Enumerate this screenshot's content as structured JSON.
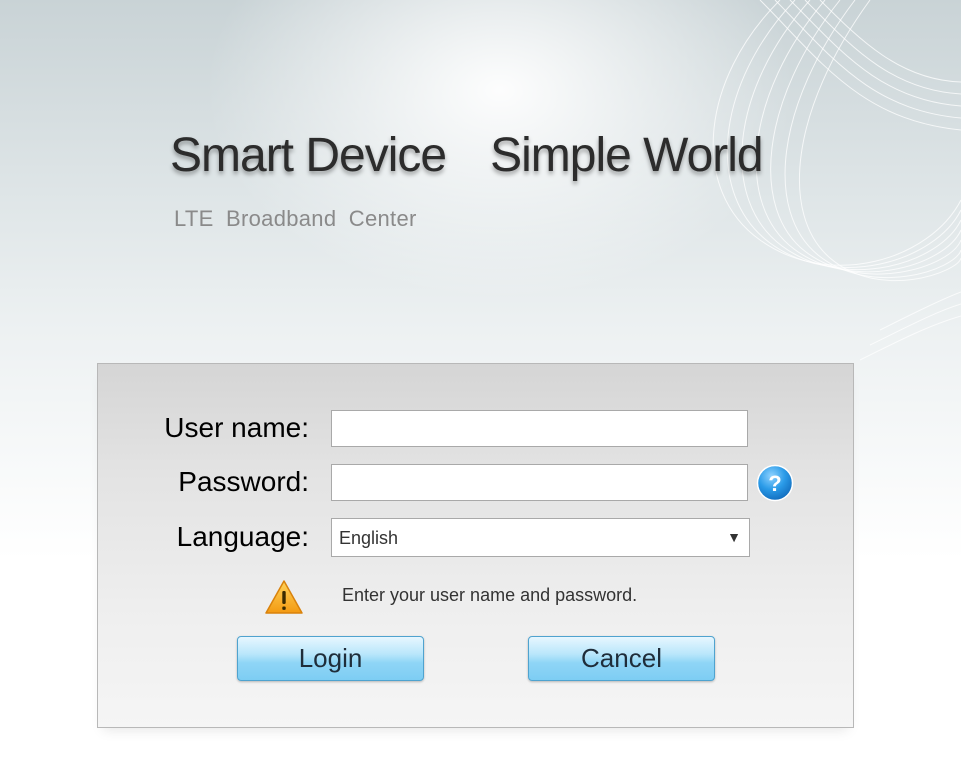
{
  "header": {
    "slogan_part1": "Smart Device",
    "slogan_part2": "Simple World",
    "subtitle": "LTE  Broadband  Center"
  },
  "login_form": {
    "username_label": "User name:",
    "username_value": "",
    "password_label": "Password:",
    "password_value": "",
    "help_icon": "question-mark-icon",
    "language_label": "Language:",
    "language_selected": "English",
    "warning_icon": "warning-triangle-icon",
    "message": "Enter your user name and password.",
    "login_label": "Login",
    "cancel_label": "Cancel"
  },
  "colors": {
    "button_gradient_top": "#e7f7ff",
    "button_gradient_bottom": "#7dcdf3",
    "help_icon_blue": "#1e8fe0",
    "warning_orange": "#f5a623"
  }
}
